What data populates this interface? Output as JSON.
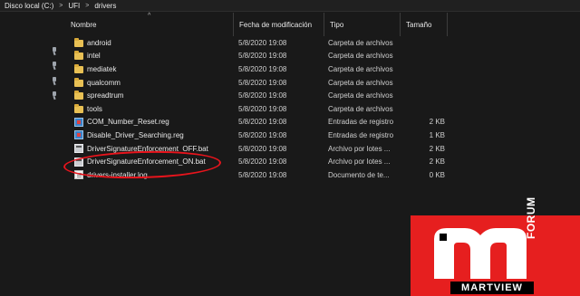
{
  "breadcrumb": [
    "Disco local (C:)",
    "UFI",
    "drivers"
  ],
  "columns": {
    "name": "Nombre",
    "date": "Fecha de modificación",
    "type": "Tipo",
    "size": "Tamaño"
  },
  "files": [
    {
      "name": "android",
      "date": "5/8/2020 19:08",
      "type": "Carpeta de archivos",
      "size": "",
      "icon": "folder-icon"
    },
    {
      "name": "intel",
      "date": "5/8/2020 19:08",
      "type": "Carpeta de archivos",
      "size": "",
      "icon": "folder-icon"
    },
    {
      "name": "mediatek",
      "date": "5/8/2020 19:08",
      "type": "Carpeta de archivos",
      "size": "",
      "icon": "folder-icon"
    },
    {
      "name": "qualcomm",
      "date": "5/8/2020 19:08",
      "type": "Carpeta de archivos",
      "size": "",
      "icon": "folder-icon"
    },
    {
      "name": "spreadtrum",
      "date": "5/8/2020 19:08",
      "type": "Carpeta de archivos",
      "size": "",
      "icon": "folder-icon"
    },
    {
      "name": "tools",
      "date": "5/8/2020 19:08",
      "type": "Carpeta de archivos",
      "size": "",
      "icon": "folder-icon"
    },
    {
      "name": "COM_Number_Reset.reg",
      "date": "5/8/2020 19:08",
      "type": "Entradas de registro",
      "size": "2 KB",
      "icon": "registry-file-icon"
    },
    {
      "name": "Disable_Driver_Searching.reg",
      "date": "5/8/2020 19:08",
      "type": "Entradas de registro",
      "size": "1 KB",
      "icon": "registry-file-icon"
    },
    {
      "name": "DriverSignatureEnforcement_OFF.bat",
      "date": "5/8/2020 19:08",
      "type": "Archivo por lotes ...",
      "size": "2 KB",
      "icon": "batch-file-icon"
    },
    {
      "name": "DriverSignatureEnforcement_ON.bat",
      "date": "5/8/2020 19:08",
      "type": "Archivo por lotes ...",
      "size": "2 KB",
      "icon": "batch-file-icon"
    },
    {
      "name": "drivers-installer.log",
      "date": "5/8/2020 19:08",
      "type": "Documento de te...",
      "size": "0 KB",
      "icon": "text-document-icon"
    }
  ],
  "watermark": {
    "forum": "FORUM",
    "brand": "MARTVIEW"
  },
  "colors": {
    "background": "#191919",
    "folder": "#e8c054",
    "highlight": "#e8141c",
    "logo": "#e61f1f"
  }
}
